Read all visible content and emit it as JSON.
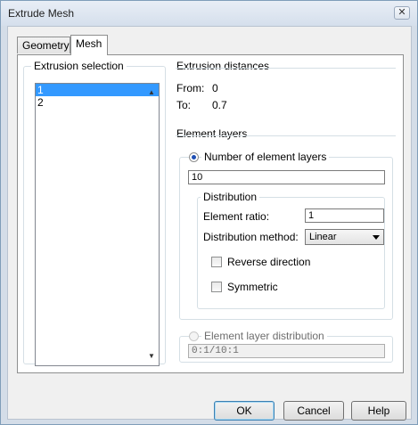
{
  "window": {
    "title": "Extrude Mesh",
    "close_label": "✕"
  },
  "tabs": [
    {
      "label": "Geometry"
    },
    {
      "label": "Mesh"
    }
  ],
  "extrusion_selection": {
    "title": "Extrusion selection",
    "items": [
      "1",
      "2"
    ]
  },
  "extrusion_distances": {
    "title": "Extrusion distances",
    "from_label": "From:",
    "from_value": "0",
    "to_label": "To:",
    "to_value": "0.7"
  },
  "element_layers": {
    "title": "Element layers",
    "number_option_label": "Number of element layers",
    "number_value": "10",
    "distribution": {
      "title": "Distribution",
      "ratio_label": "Element ratio:",
      "ratio_value": "1",
      "method_label": "Distribution method:",
      "method_value": "Linear",
      "reverse_label": "Reverse direction",
      "symmetric_label": "Symmetric"
    },
    "layer_dist_option_label": "Element layer distribution",
    "layer_dist_value": "0:1/10:1"
  },
  "buttons": {
    "ok": "OK",
    "cancel": "Cancel",
    "help": "Help"
  }
}
